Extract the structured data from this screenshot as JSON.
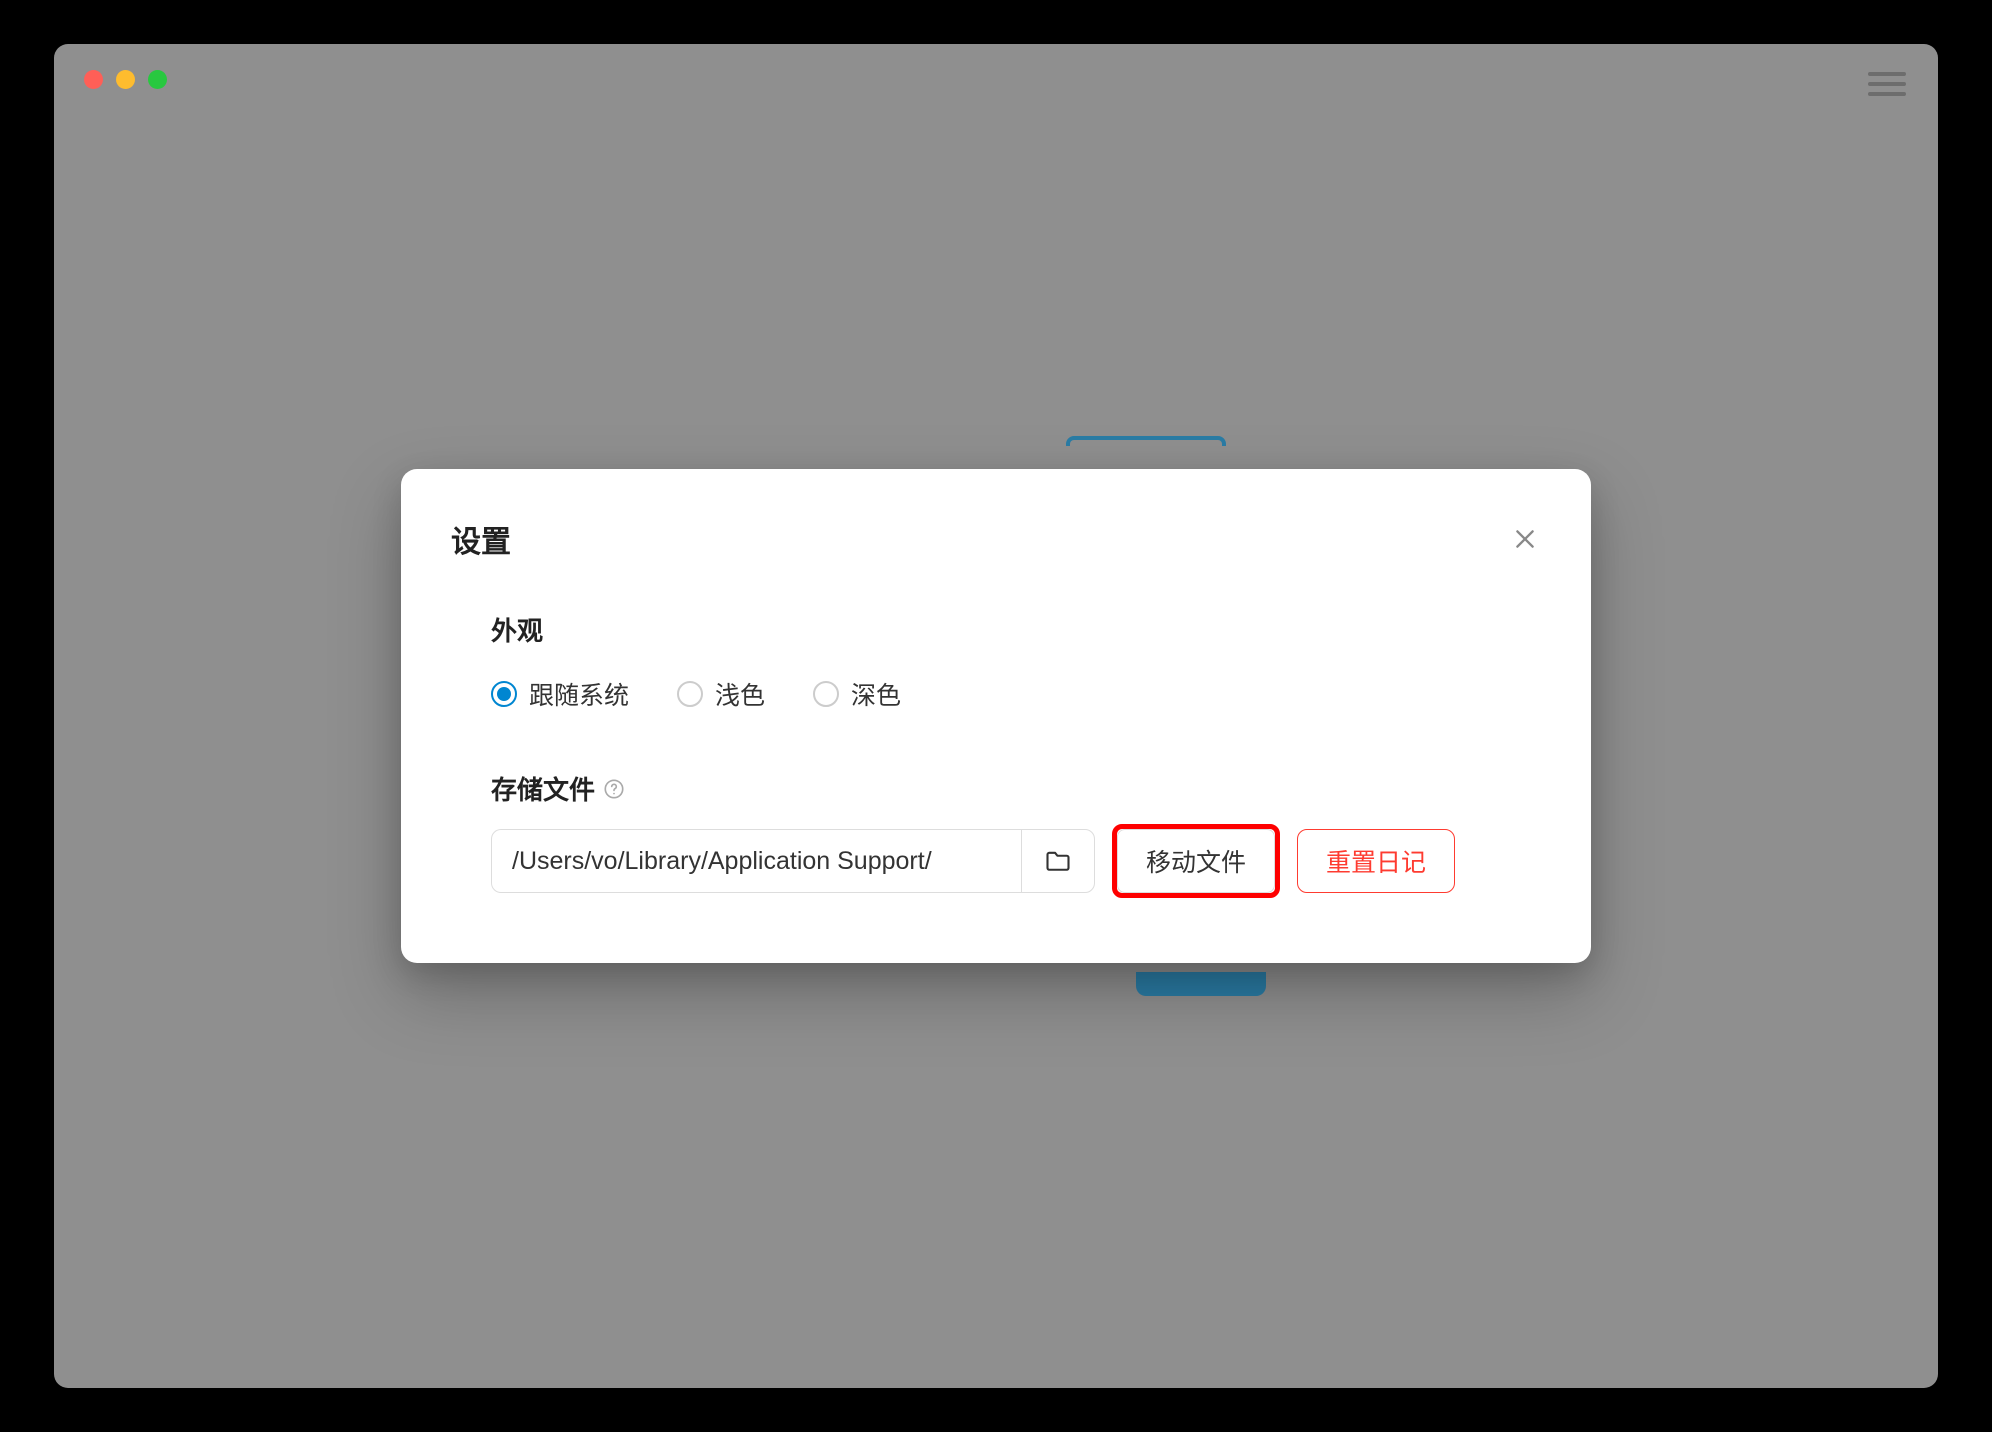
{
  "modal": {
    "title": "设置",
    "appearance": {
      "section_label": "外观",
      "options": [
        {
          "label": "跟随系统",
          "selected": true
        },
        {
          "label": "浅色",
          "selected": false
        },
        {
          "label": "深色",
          "selected": false
        }
      ]
    },
    "storage": {
      "section_label": "存储文件",
      "path_value": "/Users/vo/Library/Application Support/",
      "move_button_label": "移动文件",
      "reset_button_label": "重置日记"
    }
  },
  "colors": {
    "accent": "#0086d1",
    "danger": "#fe3b30",
    "highlight": "#fe0000"
  },
  "icons": {
    "close": "close-icon",
    "help": "help-circle-icon",
    "folder": "folder-icon",
    "hamburger": "hamburger-menu-icon"
  }
}
